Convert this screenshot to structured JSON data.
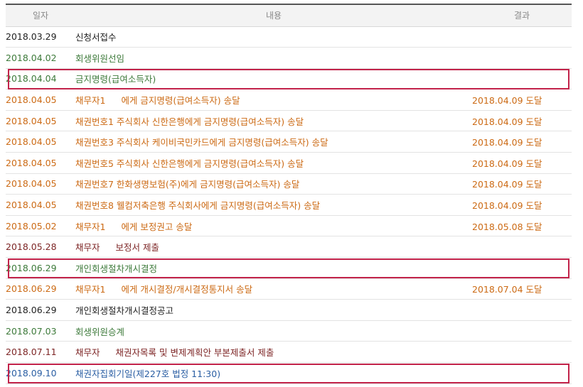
{
  "header": {
    "date": "일자",
    "content": "내용",
    "result": "결과"
  },
  "colors": {
    "black": "#222222",
    "green": "#3d7a3a",
    "orange": "#cc6a14",
    "maroon": "#7d2525",
    "blue": "#2a5ea3",
    "highlight": "#c2234a"
  },
  "rows": [
    {
      "date": "2018.03.29",
      "content": "신청서접수",
      "result": "",
      "color": "black"
    },
    {
      "date": "2018.04.02",
      "content": "회생위원선임",
      "result": "",
      "color": "green"
    },
    {
      "date": "2018.04.04",
      "content": "금지명령(급여소득자)",
      "result": "",
      "color": "green",
      "highlight": true
    },
    {
      "date": "2018.04.05",
      "content": "채무자1",
      "content_after_mask": "에게 금지명령(급여소득자) 송달",
      "result": "2018.04.09 도달",
      "color": "orange"
    },
    {
      "date": "2018.04.05",
      "content": "채권번호1 주식회사 신한은행에게 금지명령(급여소득자) 송달",
      "result": "2018.04.09 도달",
      "color": "orange"
    },
    {
      "date": "2018.04.05",
      "content": "채권번호3 주식회사 케이비국민카드에게 금지명령(급여소득자) 송달",
      "result": "2018.04.09 도달",
      "color": "orange"
    },
    {
      "date": "2018.04.05",
      "content": "채권번호5 주식회사 신한은행에게 금지명령(급여소득자) 송달",
      "result": "2018.04.09 도달",
      "color": "orange"
    },
    {
      "date": "2018.04.05",
      "content": "채권번호7 한화생명보험(주)에게 금지명령(급여소득자) 송달",
      "result": "2018.04.09 도달",
      "color": "orange"
    },
    {
      "date": "2018.04.05",
      "content": "채권번호8 웰컴저축은행 주식회사에게 금지명령(급여소득자) 송달",
      "result": "2018.04.09 도달",
      "color": "orange"
    },
    {
      "date": "2018.05.02",
      "content": "채무자1",
      "content_after_mask": "에게 보정권고 송달",
      "result": "2018.05.08 도달",
      "color": "orange"
    },
    {
      "date": "2018.05.28",
      "content": "채무자",
      "content_after_mask": "보정서 제출",
      "result": "",
      "color": "maroon"
    },
    {
      "date": "2018.06.29",
      "content": "개인회생절차개시결정",
      "result": "",
      "color": "green",
      "highlight": true
    },
    {
      "date": "2018.06.29",
      "content": "채무자1",
      "content_after_mask": "에게 개시결정/개시결정통지서 송달",
      "result": "2018.07.04 도달",
      "color": "orange"
    },
    {
      "date": "2018.06.29",
      "content": "개인회생절차개시결정공고",
      "result": "",
      "color": "black"
    },
    {
      "date": "2018.07.03",
      "content": "회생위원승계",
      "result": "",
      "color": "green"
    },
    {
      "date": "2018.07.11",
      "content": "채무자",
      "content_after_mask": "채권자목록 및 변제계획안 부본제출서 제출",
      "result": "",
      "color": "maroon"
    },
    {
      "date": "2018.09.10",
      "content": "채권자집회기일(제227호 법정 11:30)",
      "result": "",
      "color": "blue",
      "highlight": true
    }
  ]
}
